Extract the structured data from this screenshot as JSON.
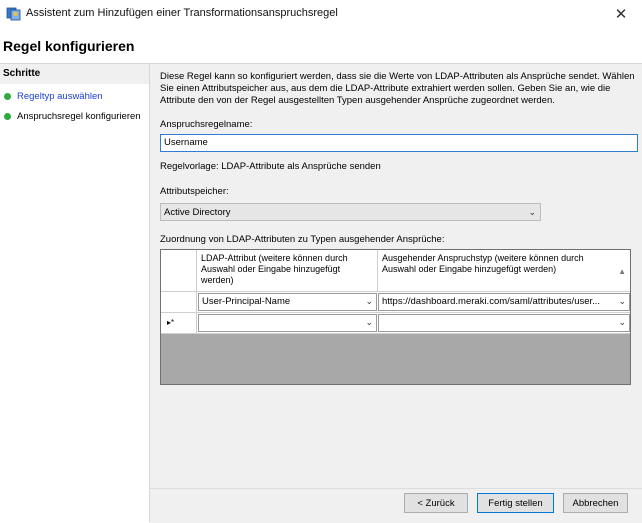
{
  "window": {
    "title": "Assistent zum Hinzufügen einer Transformationsanspruchsregel",
    "close_glyph": "✕"
  },
  "page_heading": "Regel konfigurieren",
  "steps": {
    "title": "Schritte",
    "items": [
      {
        "label": "Regeltyp auswählen",
        "status": "completed",
        "link": true
      },
      {
        "label": "Anspruchsregel konfigurieren",
        "status": "current",
        "link": false
      }
    ]
  },
  "main": {
    "description": "Diese Regel kann so konfiguriert werden, dass sie die Werte von LDAP-Attributen als Ansprüche sendet. Wählen Sie einen Attributspeicher aus, aus dem die LDAP-Attribute extrahiert werden sollen. Geben Sie an, wie die Attribute den von der Regel ausgestellten Typen ausgehender Ansprüche zugeordnet werden.",
    "claim_rule_name_label": "Anspruchsregelname:",
    "claim_rule_name_value": "Username",
    "rule_template_text": "Regelvorlage: LDAP-Attribute als Ansprüche senden",
    "attribute_store_label": "Attributspeicher:",
    "attribute_store_value": "Active Directory",
    "mapping_label": "Zuordnung von LDAP-Attributen zu Typen ausgehender Ansprüche:",
    "grid": {
      "columns": [
        "LDAP-Attribut (weitere können durch Auswahl oder Eingabe hinzugefügt werden)",
        "Ausgehender Anspruchstyp (weitere können durch Auswahl oder Eingabe hinzugefügt werden)"
      ],
      "rows": [
        {
          "marker": "",
          "ldap": "User-Principal-Name",
          "claim": "https://dashboard.meraki.com/saml/attributes/user..."
        },
        {
          "marker": "▸*",
          "ldap": "",
          "claim": ""
        }
      ]
    }
  },
  "footer": {
    "back": "< Zurück",
    "finish": "Fertig stellen",
    "cancel": "Abbrechen"
  },
  "colors": {
    "accent": "#0078d7",
    "link": "#1a3fd6",
    "step_dot": "#2eaa3c",
    "panel_bg": "#f0f0f0"
  }
}
